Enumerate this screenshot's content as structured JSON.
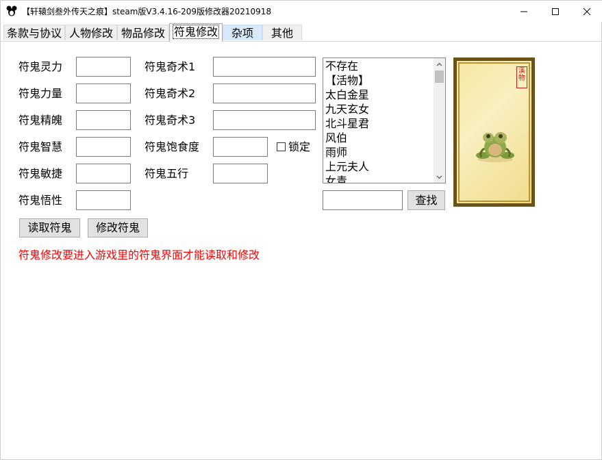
{
  "window": {
    "title": "【轩辕剑叁外传天之痕】steam版V3.4.16-209版修改器20210918"
  },
  "tabs": [
    {
      "label": "条款与协议"
    },
    {
      "label": "人物修改"
    },
    {
      "label": "物品修改"
    },
    {
      "label": "符鬼修改"
    },
    {
      "label": "杂项"
    },
    {
      "label": "其他"
    }
  ],
  "left_fields": [
    {
      "label": "符鬼灵力",
      "value": ""
    },
    {
      "label": "符鬼力量",
      "value": ""
    },
    {
      "label": "符鬼精魄",
      "value": ""
    },
    {
      "label": "符鬼智慧",
      "value": ""
    },
    {
      "label": "符鬼敏捷",
      "value": ""
    },
    {
      "label": "符鬼悟性",
      "value": ""
    }
  ],
  "mid_fields": [
    {
      "label": "符鬼奇术1",
      "value": ""
    },
    {
      "label": "符鬼奇术2",
      "value": ""
    },
    {
      "label": "符鬼奇术3",
      "value": ""
    },
    {
      "label": "符鬼饱食度",
      "value": ""
    },
    {
      "label": "符鬼五行",
      "value": ""
    }
  ],
  "lock_label": "锁定",
  "list_items": [
    "不存在",
    "【活物】",
    "太白金星",
    "九天玄女",
    "北斗星君",
    "风伯",
    "雨师",
    "上元夫人",
    "女青"
  ],
  "search": {
    "value": "",
    "button_label": "查找"
  },
  "buttons": {
    "read_label": "读取符鬼",
    "modify_label": "修改符鬼"
  },
  "notice": "符鬼修改要进入游戏里的符鬼界面才能读取和修改",
  "portrait": {
    "seal_text": "溪物"
  },
  "colors": {
    "notice": "#ff0000",
    "tab_hover": "#d8eaf9",
    "frame": "#6b5217"
  }
}
